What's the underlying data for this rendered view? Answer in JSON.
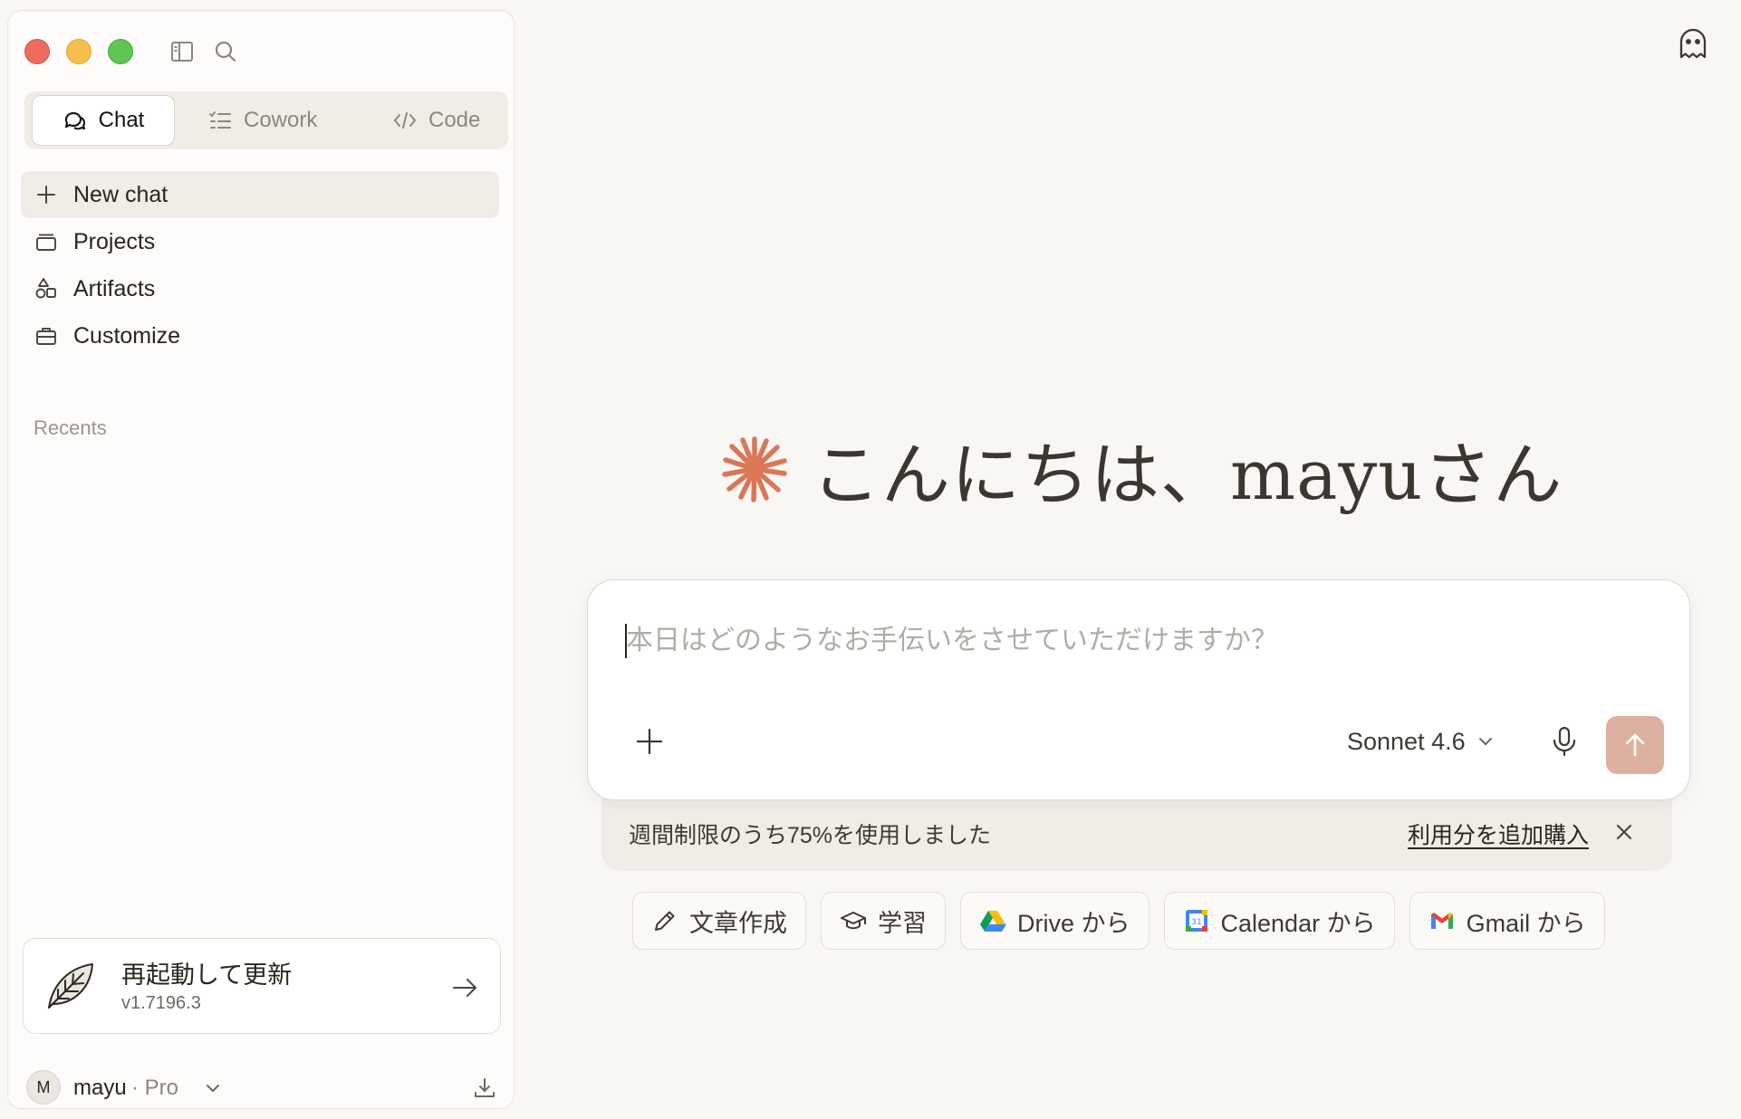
{
  "sidebar": {
    "mode_tabs": [
      {
        "label": "Chat",
        "icon": "chat-bubbles-icon",
        "active": true
      },
      {
        "label": "Cowork",
        "icon": "checklist-icon",
        "active": false
      },
      {
        "label": "Code",
        "icon": "code-brackets-icon",
        "active": false
      }
    ],
    "nav": [
      {
        "label": "New chat",
        "icon": "plus-icon"
      },
      {
        "label": "Projects",
        "icon": "folder-stack-icon"
      },
      {
        "label": "Artifacts",
        "icon": "shapes-icon"
      },
      {
        "label": "Customize",
        "icon": "briefcase-icon"
      }
    ],
    "recents_title": "Recents",
    "update": {
      "title": "再起動して更新",
      "version": "v1.7196.3"
    },
    "account": {
      "initial": "M",
      "name": "mayu",
      "plan": "· Pro"
    }
  },
  "main": {
    "greeting": "こんにちは、mayuさん",
    "composer": {
      "placeholder": "本日はどのようなお手伝いをさせていただけますか？",
      "value": "",
      "model": "Sonnet 4.6"
    },
    "usage": {
      "text": "週間制限のうち75%を使用しました",
      "link": "利用分を追加購入",
      "percent_used": 75
    },
    "chips": [
      {
        "label": "文章作成",
        "icon": "pencil-icon"
      },
      {
        "label": "学習",
        "icon": "graduation-cap-icon"
      },
      {
        "label": "Drive から",
        "icon": "google-drive-icon"
      },
      {
        "label": "Calendar から",
        "icon": "google-calendar-icon"
      },
      {
        "label": "Gmail から",
        "icon": "gmail-icon"
      }
    ]
  },
  "colors": {
    "background": "#f8f7f3",
    "accent": "#d97757",
    "send_button": "#ddb0a0",
    "traffic_close": "#ed6a5e",
    "traffic_minimize": "#f4bf4f",
    "traffic_maximize": "#61c554"
  }
}
